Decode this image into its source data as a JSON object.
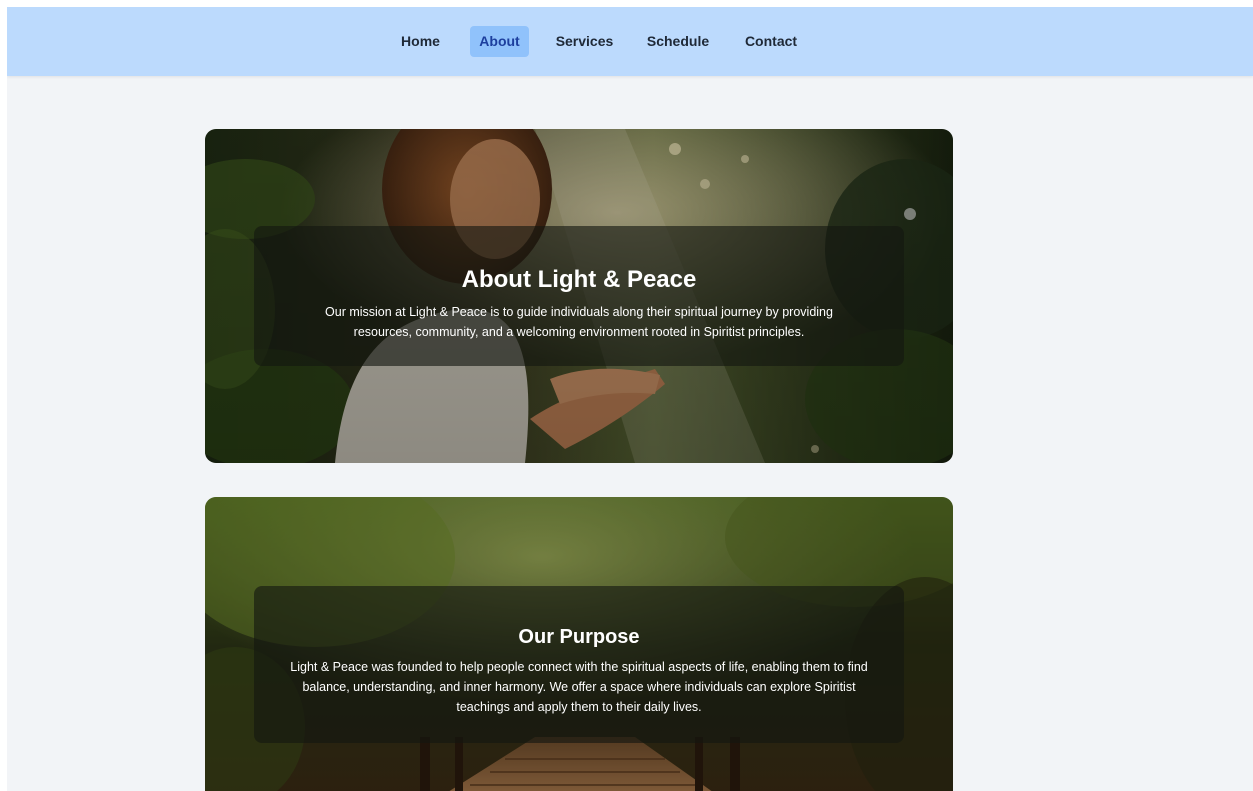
{
  "nav": {
    "items": [
      {
        "label": "Home",
        "active": false
      },
      {
        "label": "About",
        "active": true
      },
      {
        "label": "Services",
        "active": false
      },
      {
        "label": "Schedule",
        "active": false
      },
      {
        "label": "Contact",
        "active": false
      }
    ]
  },
  "hero": {
    "title": "About Light & Peace",
    "text": "Our mission at Light & Peace is to guide individuals along their spiritual journey by providing resources, community, and a welcoming environment rooted in Spiritist principles."
  },
  "purpose": {
    "title": "Our Purpose",
    "text": "Light & Peace was founded to help people connect with the spiritual aspects of life, enabling them to find balance, understanding, and inner harmony. We offer a space where individuals can explore Spiritist teachings and apply them to their daily lives."
  },
  "colors": {
    "nav_background": "#bcdafd",
    "nav_active_background": "#90c2fb",
    "nav_active_text": "#1d3f9e",
    "page_background": "#f2f4f7"
  }
}
